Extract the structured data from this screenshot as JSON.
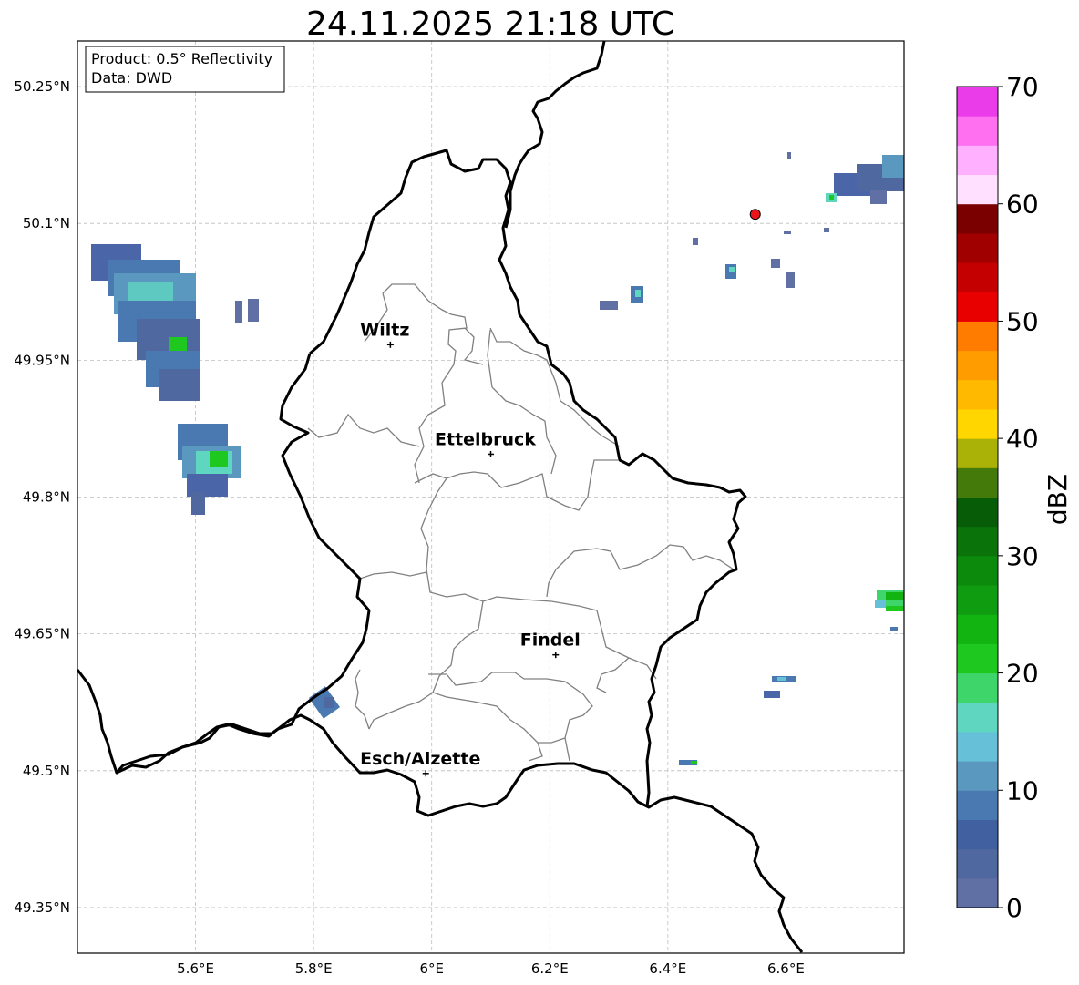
{
  "title": "24.11.2025 21:18 UTC",
  "info_box": {
    "product": "Product: 0.5° Reflectivity",
    "data": "Data: DWD"
  },
  "map": {
    "lon_range": [
      5.4,
      6.8
    ],
    "lat_range": [
      49.3,
      50.3
    ],
    "x_ticks": [
      {
        "value": 5.6,
        "label": "5.6°E"
      },
      {
        "value": 5.8,
        "label": "5.8°E"
      },
      {
        "value": 6.0,
        "label": "6°E"
      },
      {
        "value": 6.2,
        "label": "6.2°E"
      },
      {
        "value": 6.4,
        "label": "6.4°E"
      },
      {
        "value": 6.6,
        "label": "6.6°E"
      }
    ],
    "y_ticks": [
      {
        "value": 50.25,
        "label": "50.25°N"
      },
      {
        "value": 50.1,
        "label": "50.1°N"
      },
      {
        "value": 49.95,
        "label": "49.95°N"
      },
      {
        "value": 49.8,
        "label": "49.8°N"
      },
      {
        "value": 49.65,
        "label": "49.65°N"
      },
      {
        "value": 49.5,
        "label": "49.5°N"
      },
      {
        "value": 49.35,
        "label": "49.35°N"
      }
    ],
    "cities": [
      {
        "name": "Wiltz",
        "lon": 5.93,
        "lat": 49.967
      },
      {
        "name": "Ettelbruck",
        "lon": 6.1,
        "lat": 49.847
      },
      {
        "name": "Findel",
        "lon": 6.21,
        "lat": 49.627
      },
      {
        "name": "Esch/Alzette",
        "lon": 5.99,
        "lat": 49.497
      }
    ],
    "radar_site": {
      "lon": 6.548,
      "lat": 50.11,
      "color": "#e8161b"
    }
  },
  "colorbar": {
    "label": "dBZ",
    "min": 0,
    "max": 70,
    "ticks": [
      {
        "value": 0,
        "label": "0"
      },
      {
        "value": 10,
        "label": "10"
      },
      {
        "value": 20,
        "label": "20"
      },
      {
        "value": 30,
        "label": "30"
      },
      {
        "value": 40,
        "label": "40"
      },
      {
        "value": 50,
        "label": "50"
      },
      {
        "value": 60,
        "label": "60"
      },
      {
        "value": 70,
        "label": "70"
      }
    ],
    "colors": [
      "#6070a5",
      "#5068a0",
      "#4060a0",
      "#4a78b0",
      "#5a98c0",
      "#66c0d8",
      "#5ed6c0",
      "#3ed66a",
      "#1ec81e",
      "#12b412",
      "#109c10",
      "#0c8a0c",
      "#0a740a",
      "#075c07",
      "#447a0a",
      "#aab208",
      "#ffd600",
      "#ffba00",
      "#ff9c00",
      "#ff7c00",
      "#e80000",
      "#c40000",
      "#a00000",
      "#7a0000",
      "#ffe0ff",
      "#ffb0ff",
      "#ff70f0",
      "#ea3ce8"
    ]
  }
}
